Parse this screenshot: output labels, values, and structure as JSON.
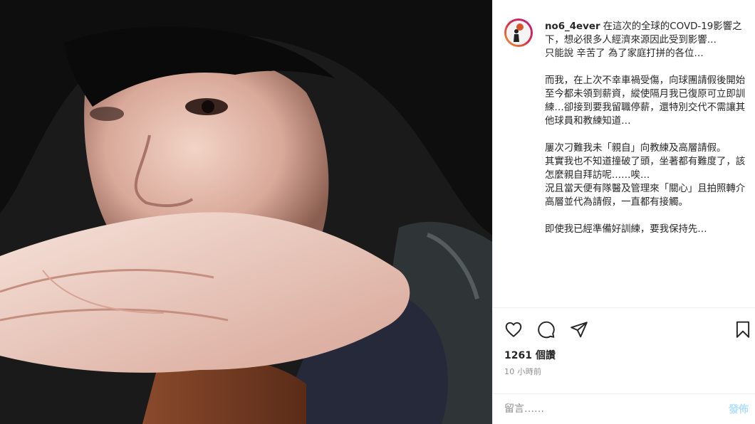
{
  "post": {
    "username": "no6_4ever",
    "caption": "在這次的全球的COVD-19影響之下，想必很多人經濟來源因此受到影響…\n只能說 辛苦了 為了家庭打拼的各位…\n\n而我，在上次不幸車禍受傷，向球團請假後開始至今都未領到薪資，縱使隔月我已復原可立即訓練…卻接到要我留職停薪，還特別交代不需讓其他球員和教練知道…\n\n屢次刁難我未「親自」向教練及高層請假。\n其實我也不知道撞破了頭，坐著都有難度了，該怎麼親自拜訪呢……唉…\n況且當天便有隊醫及管理來「關心」且拍照轉介高層並代為請假，一直都有接觸。\n\n即使我已經準備好訓練，要我保持先…",
    "likes": "1261 個讚",
    "time": "10 小時前"
  },
  "icons": {
    "like": "heart-icon",
    "comment": "comment-icon",
    "share": "share-icon",
    "save": "bookmark-icon"
  },
  "comment": {
    "placeholder": "留言……",
    "post_label": "發佈"
  },
  "colors": {
    "accent": "#0095f6",
    "post_disabled": "#b2dffc",
    "muted": "#8e8e8e"
  }
}
